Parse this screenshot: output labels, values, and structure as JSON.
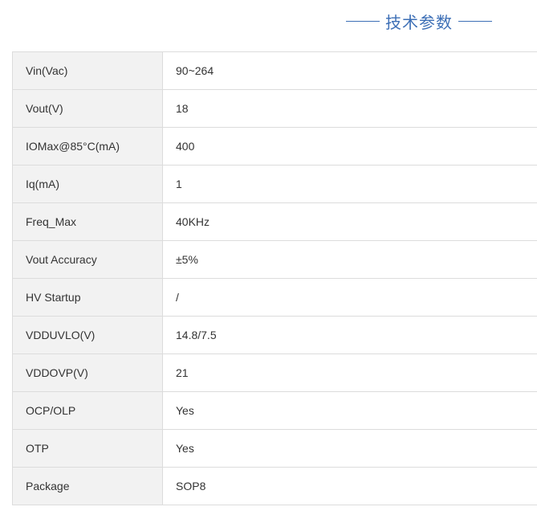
{
  "section": {
    "title": "技术参数"
  },
  "specs": [
    {
      "param": "Vin(Vac)",
      "value": "90~264"
    },
    {
      "param": "Vout(V)",
      "value": "18"
    },
    {
      "param": "IOMax@85°C(mA)",
      "value": "400"
    },
    {
      "param": "Iq(mA)",
      "value": "1"
    },
    {
      "param": "Freq_Max",
      "value": "40KHz"
    },
    {
      "param": "Vout Accuracy",
      "value": "±5%"
    },
    {
      "param": "HV Startup",
      "value": "/"
    },
    {
      "param": "VDDUVLO(V)",
      "value": "14.8/7.5"
    },
    {
      "param": "VDDOVP(V)",
      "value": "21"
    },
    {
      "param": "OCP/OLP",
      "value": "Yes"
    },
    {
      "param": "OTP",
      "value": "Yes"
    },
    {
      "param": "Package",
      "value": "SOP8"
    }
  ],
  "colors": {
    "accent": "#3d6fb6",
    "label_bg": "#f2f2f2",
    "border": "#dcdcdc",
    "text": "#333333"
  }
}
